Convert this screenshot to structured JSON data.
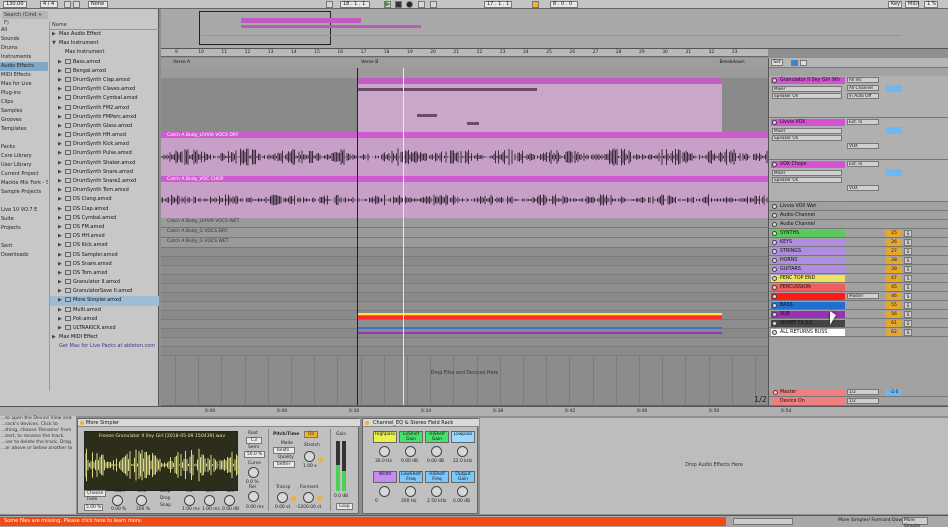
{
  "transport": {
    "tempo": "130.00",
    "sig": "4 / 4",
    "quant": "None",
    "pos": "18 . 1 . 1",
    "loop_start": "17 . 1 . 1",
    "loop_len": "8 . 0 . 0",
    "key": "Key",
    "midi": "MIDI",
    "cpu": "1 %"
  },
  "browser": {
    "search": "Search (Cmd + F)",
    "places": [
      "All",
      "Sounds",
      "Drums",
      "Instruments",
      "Audio Effects",
      "MIDI Effects",
      "Max for Live",
      "Plug-ins",
      "Clips",
      "Samples",
      "Grooves",
      "Templates",
      "",
      "Packs",
      "Core Library",
      "User Library",
      "Current Project",
      "Mackie Mix Fork - Sample Pack",
      "Sample Projects",
      "",
      "Live 10 VO.7 E",
      "Suite",
      "Projects",
      "",
      "Sent",
      "Downloads"
    ],
    "places_selected": 4,
    "name_header": "Name",
    "tree": [
      {
        "t": "Max Audio Effect",
        "tri": "▶",
        "lvl": 0
      },
      {
        "t": "Max Instrument",
        "tri": "▼",
        "lvl": 0
      },
      {
        "t": "Max Instrument",
        "tri": "",
        "lvl": 1
      },
      {
        "t": "Bass.amxd",
        "tri": "▶",
        "lvl": 1
      },
      {
        "t": "Bengal.amxd",
        "tri": "▶",
        "lvl": 1
      },
      {
        "t": "DrumSynth Clap.amxd",
        "tri": "▶",
        "lvl": 1
      },
      {
        "t": "DrumSynth Claves.amxd",
        "tri": "▶",
        "lvl": 1
      },
      {
        "t": "DrumSynth Cymbal.amxd",
        "tri": "▶",
        "lvl": 1
      },
      {
        "t": "DrumSynth FM2.amxd",
        "tri": "▶",
        "lvl": 1
      },
      {
        "t": "DrumSynth FMPerc.amxd",
        "tri": "▶",
        "lvl": 1
      },
      {
        "t": "DrumSynth Glass.amxd",
        "tri": "▶",
        "lvl": 1
      },
      {
        "t": "DrumSynth HH.amxd",
        "tri": "▶",
        "lvl": 1
      },
      {
        "t": "DrumSynth Kick.amxd",
        "tri": "▶",
        "lvl": 1
      },
      {
        "t": "DrumSynth Pulse.amxd",
        "tri": "▶",
        "lvl": 1
      },
      {
        "t": "DrumSynth Shaker.amxd",
        "tri": "▶",
        "lvl": 1
      },
      {
        "t": "DrumSynth Snare.amxd",
        "tri": "▶",
        "lvl": 1
      },
      {
        "t": "DrumSynth Snare2.amxd",
        "tri": "▶",
        "lvl": 1
      },
      {
        "t": "DrumSynth Tom.amxd",
        "tri": "▶",
        "lvl": 1
      },
      {
        "t": "DS Clang.amxd",
        "tri": "▶",
        "lvl": 1
      },
      {
        "t": "DS Clap.amxd",
        "tri": "▶",
        "lvl": 1
      },
      {
        "t": "DS Cymbal.amxd",
        "tri": "▶",
        "lvl": 1
      },
      {
        "t": "DS FM.amxd",
        "tri": "▶",
        "lvl": 1
      },
      {
        "t": "DS HH.amxd",
        "tri": "▶",
        "lvl": 1
      },
      {
        "t": "DS Kick.amxd",
        "tri": "▶",
        "lvl": 1
      },
      {
        "t": "DS Sampler.amxd",
        "tri": "▶",
        "lvl": 1
      },
      {
        "t": "DS Snare.amxd",
        "tri": "▶",
        "lvl": 1
      },
      {
        "t": "DS Tom.amxd",
        "tri": "▶",
        "lvl": 1
      },
      {
        "t": "Granulator II.amxd",
        "tri": "▶",
        "lvl": 1
      },
      {
        "t": "GranulatorSave II.amxd",
        "tri": "▶",
        "lvl": 1
      },
      {
        "t": "More Simpler.amxd",
        "tri": "▶",
        "lvl": 1,
        "sel": true
      },
      {
        "t": "Multi.amxd",
        "tri": "▶",
        "lvl": 1
      },
      {
        "t": "Poli.amxd",
        "tri": "▶",
        "lvl": 1
      },
      {
        "t": "ULTRAKICK.amxd",
        "tri": "▶",
        "lvl": 1
      },
      {
        "t": "Max MIDI Effect",
        "tri": "▶",
        "lvl": 0
      },
      {
        "t": "Get Max for Live Packs at ableton.com",
        "tri": "",
        "lvl": 0,
        "link": true
      }
    ]
  },
  "ruler": {
    "bars": [
      "9",
      "10",
      "11",
      "12",
      "13",
      "14",
      "15",
      "16",
      "17",
      "18",
      "19",
      "20",
      "21",
      "22",
      "23",
      "24",
      "25",
      "26",
      "27",
      "28",
      "29",
      "30",
      "31",
      "32",
      "33"
    ]
  },
  "locators": [
    {
      "t": "Verse A",
      "pos": 0.02
    },
    {
      "t": "Verse B",
      "pos": 0.33
    },
    {
      "t": "Breakdown",
      "pos": 0.92
    }
  ],
  "clips": {
    "granulator": "Catch A Body_VOC VOCS",
    "livvia": "Catch A Body_LIVVIA VOCS DRY",
    "vox": "Catch A Body_VOC CHOP",
    "wet1": "Catch A Body_LIVVIA VOCS WET",
    "wet2": "Catch A Body_G VOCS DRY",
    "wet3": "Catch A Body_G VOCS WET"
  },
  "drop_text": "Drop Files and Devices Here",
  "time_ruler": [
    "0:00",
    "0:00",
    "0:30",
    "0:34",
    "0:38",
    "0:42",
    "0:46",
    "0:50",
    "0:54"
  ],
  "fraction": "1/2",
  "tracks": [
    {
      "name": "Granulator II 0ey Girl 9th",
      "color": "#d552d5",
      "num": "",
      "in": "All Ins",
      "ch": "All Channel",
      "mon": "In Auto Off",
      "routing": "Mixer",
      "out": "Speaker On",
      "big": true
    },
    {
      "name": "Livvia VOX",
      "color": "#d552d5",
      "num": "",
      "in": "Ext. In",
      "routing": "Mixer",
      "out": "Speaker On",
      "vox": "VOX",
      "big": true
    },
    {
      "name": "VOX Chops",
      "color": "#d552d5",
      "num": "",
      "in": "Ext. In",
      "routing": "Mixer",
      "out": "Speaker On",
      "vox": "VOX",
      "big": true
    },
    {
      "name": "Livvia VOX Wet",
      "color": "#a0a0a0",
      "num": ""
    },
    {
      "name": "Audio Channel",
      "color": "#a0a0a0",
      "num": ""
    },
    {
      "name": "Audio Channel",
      "color": "#a0a0a0",
      "num": ""
    },
    {
      "name": "SYNTHS",
      "color": "#5cc95c",
      "num": "25"
    },
    {
      "name": "KEYS",
      "color": "#b08de0",
      "num": "26"
    },
    {
      "name": "STRINGS",
      "color": "#b08de0",
      "num": "27"
    },
    {
      "name": "HORNS",
      "color": "#b08de0",
      "num": "28"
    },
    {
      "name": "GUITARS",
      "color": "#b08de0",
      "num": "39"
    },
    {
      "name": "PERC TOP END",
      "color": "#f2e15a",
      "num": "47"
    },
    {
      "name": "PERCUSSION",
      "color": "#ef5e5e",
      "num": "45"
    },
    {
      "name": "DRUMS",
      "color": "#ff1a1a",
      "num": "46",
      "out": "Master",
      "red": true
    },
    {
      "name": "BASS",
      "color": "#1f6fd1",
      "num": "55"
    },
    {
      "name": "SUB",
      "color": "#9a2fb8",
      "num": "56"
    },
    {
      "name": "SHORT FX S/C",
      "color": "#444444",
      "num": "61"
    },
    {
      "name": "ALL RETURNS BUSS",
      "color": "#ffffff",
      "num": "62"
    }
  ],
  "master": {
    "name": "Master",
    "out": "1/2",
    "dev": "Device On",
    "num": "1/2",
    "vol": "-2.0"
  },
  "header_icons": [
    "Set"
  ],
  "simpler": {
    "title": "More Simpler",
    "file": "Freeze Granulator II 0ey Girl [2018-05-09 150439].wav",
    "root_label": "Root",
    "root": "C3",
    "semi_label": "Semi",
    "semi": "50.0 %",
    "curve_label": "Curve",
    "curve": "0.0 %",
    "rel_label": "Rel",
    "rel": "0.00 ms",
    "choose": "Choose",
    "fade_label": "Fade",
    "fade": "5.00 %",
    "start_label": "Start",
    "start": "0.00 %",
    "end_label": "End",
    "end": "100 %",
    "loop": "Loop",
    "drop": "Drop",
    "snap": "Snap",
    "att_label": "Att",
    "att": "1.00 ms",
    "dec_label": "Dec",
    "dec": "1.00 ms",
    "sus_label": "Sus",
    "sus": "0.00 dB",
    "pitch_title": "Pitch/Time",
    "on": "On",
    "mode_label": "Mode",
    "mode": "beats",
    "quality_label": "Quality",
    "quality": "better",
    "stretch_label": "Stretch",
    "stretch": "1.00 x",
    "transp_label": "Transp",
    "transp": "0.00 st",
    "formant_label": "Formant",
    "formant": "-1200.00 ct",
    "gain_label": "Gain",
    "gain": "0.0 dB",
    "loop_btn": "Loop"
  },
  "eqrack": {
    "title": "Channel_EQ & Stereo Field Rack",
    "macros": [
      {
        "t": "Highpass",
        "c": "#e9f24a"
      },
      {
        "t": "LoShelf Gain",
        "c": "#47e06a"
      },
      {
        "t": "HiShelf Gain",
        "c": "#47e06a"
      },
      {
        "t": "Lowpass",
        "c": "#9bd7ff"
      },
      {
        "t": "Width",
        "c": "#c68bf2"
      },
      {
        "t": "LowShelf Freq",
        "c": "#79c9ff"
      },
      {
        "t": "HiShelf Freq",
        "c": "#79c9ff"
      },
      {
        "t": "Output Gain",
        "c": "#79c9ff"
      }
    ],
    "vals": [
      "30.0 Hz",
      "0.00 dB",
      "0.00 dB",
      "22.0 kHz",
      "0",
      "200 Hz",
      "2.50 kHz",
      "0.00 dB"
    ]
  },
  "drop_fx": "Drop Audio Effects Here",
  "device_help": [
    "...to open the Device View and",
    "...rack's devices. Click to",
    "...thing, choose 'Rename' from",
    "...text, to rename the track.",
    "...ver to delete the track. Drag",
    "...ar above or below another to"
  ],
  "status": {
    "warning": "Some files are missing. Please click here to learn more.",
    "track": "More Simpler/ Formant Down",
    "dev": "More Simpler"
  },
  "colors": {
    "magenta": "#cf5ccf",
    "clip": "#c7a0c7",
    "drums": "#ff1a1a",
    "orange": "#f24a12"
  }
}
